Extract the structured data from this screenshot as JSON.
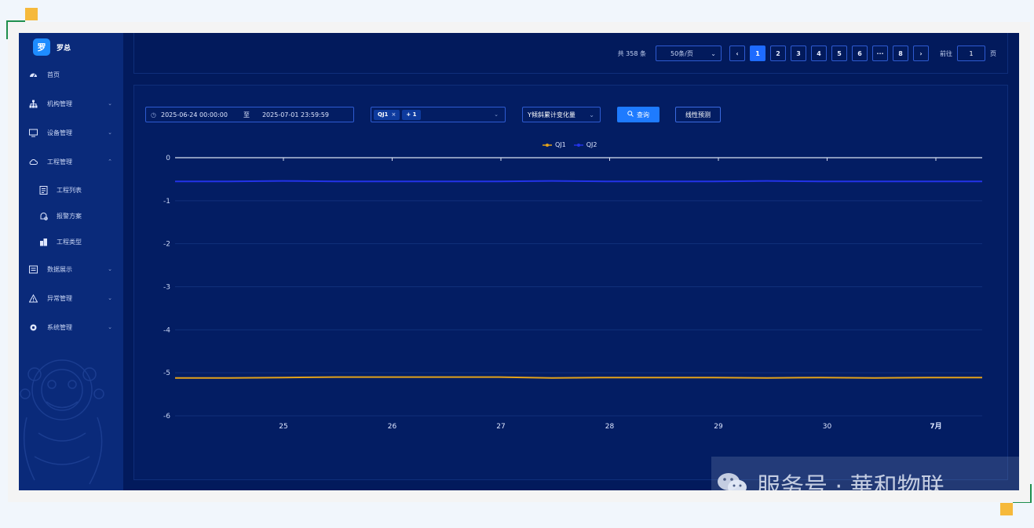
{
  "app": {
    "brand": "罗总",
    "brand_logo_text": "罗"
  },
  "sidebar": {
    "items": [
      {
        "label": "首页",
        "icon": "dashboard-icon",
        "arrow": ""
      },
      {
        "label": "机构管理",
        "icon": "org-icon",
        "arrow": "⌄"
      },
      {
        "label": "设备管理",
        "icon": "monitor-icon",
        "arrow": "⌄"
      },
      {
        "label": "工程管理",
        "icon": "cloud-icon",
        "arrow": "⌃"
      },
      {
        "label": "工程列表",
        "icon": "list-icon",
        "arrow": ""
      },
      {
        "label": "报警方案",
        "icon": "alarm-icon",
        "arrow": ""
      },
      {
        "label": "工程类型",
        "icon": "building-icon",
        "arrow": ""
      },
      {
        "label": "数据展示",
        "icon": "data-icon",
        "arrow": "⌄"
      },
      {
        "label": "异常管理",
        "icon": "warning-icon",
        "arrow": "⌄"
      },
      {
        "label": "系统管理",
        "icon": "gear-icon",
        "arrow": "⌄"
      }
    ]
  },
  "pagination": {
    "total": "共 358 条",
    "page_size": "50条/页",
    "prev": "‹",
    "pages": [
      "1",
      "2",
      "3",
      "4",
      "5",
      "6",
      "···",
      "8"
    ],
    "next": "›",
    "goto_label": "前往",
    "goto_value": "1",
    "goto_suffix": "页"
  },
  "filters": {
    "start_time": "2025-06-24 00:00:00",
    "separator": "至",
    "end_time": "2025-07-01 23:59:59",
    "tag_1": "QJ1",
    "tag_close": "×",
    "tag_more": "+ 1",
    "y_option": "Y倾斜累计变化量",
    "query_button": "查询",
    "linear_button": "线性预测"
  },
  "chart_data": {
    "type": "line",
    "title": "",
    "xlabel": "",
    "ylabel": "",
    "ylim": [
      -6,
      0
    ],
    "yticks": [
      "0",
      "-1",
      "-2",
      "-3",
      "-4",
      "-5",
      "-6"
    ],
    "xticks": [
      "25",
      "26",
      "27",
      "28",
      "29",
      "30",
      "7月"
    ],
    "legend_position": "top-center",
    "grid": true,
    "series": [
      {
        "name": "QJ1",
        "color": "#e3a21a",
        "values": [
          -5.12,
          -5.12,
          -5.11,
          -5.1,
          -5.1,
          -5.1,
          -5.1,
          -5.12,
          -5.11,
          -5.11,
          -5.11,
          -5.12,
          -5.11,
          -5.12,
          -5.11,
          -5.11
        ]
      },
      {
        "name": "QJ2",
        "color": "#2333e8",
        "values": [
          -0.55,
          -0.55,
          -0.54,
          -0.55,
          -0.55,
          -0.55,
          -0.55,
          -0.54,
          -0.55,
          -0.55,
          -0.55,
          -0.54,
          -0.55,
          -0.55,
          -0.55,
          -0.55
        ]
      }
    ]
  },
  "watermark": {
    "text": "服务号 · 華和物联",
    "icon": "wechat-icon"
  }
}
